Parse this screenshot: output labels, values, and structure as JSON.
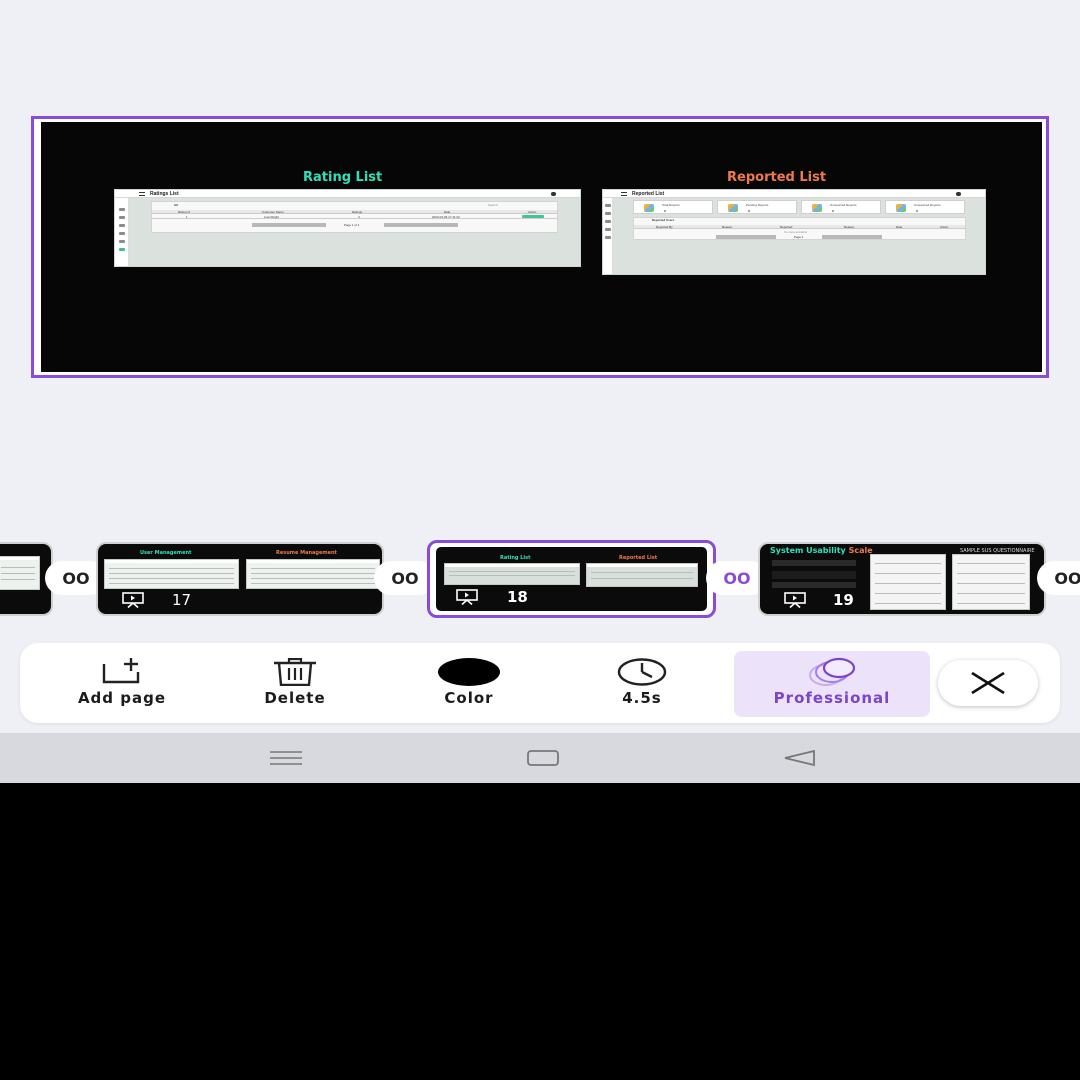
{
  "preview": {
    "left_heading": "Rating List",
    "right_heading": "Reported List",
    "left_heading_color": "#2fe0b8",
    "right_heading_color": "#f07a4a",
    "rating_shot": {
      "title": "Ratings List",
      "filter": "All",
      "search": "Search",
      "columns": [
        "Rating Id",
        "Customer Name",
        "Ratings",
        "Date",
        "Action"
      ],
      "row": [
        "1",
        "Lisa Wright",
        "4",
        "2023-03-09 17:11:32",
        "View"
      ],
      "pagination": "Page 1 of 1"
    },
    "reported_shot": {
      "title": "Reported List",
      "cards": [
        {
          "label": "Total Reports",
          "value": "0"
        },
        {
          "label": "Pending Reports",
          "value": "0"
        },
        {
          "label": "Unresolved Reports",
          "value": "0"
        },
        {
          "label": "Unresolved Reports",
          "value": "0"
        }
      ],
      "section": "Reported Users",
      "columns": [
        "Reported By",
        "Reason",
        "Reported",
        "Reason",
        "Date",
        "Action"
      ],
      "empty": "No data available",
      "pagination": "Page 1"
    }
  },
  "thumbnails": [
    {
      "number": "",
      "left_label": "",
      "right_label": ""
    },
    {
      "number": "17",
      "left_label": "User Management",
      "right_label": "Resume Management"
    },
    {
      "number": "18",
      "left_label": "Rating List",
      "right_label": "Reported List"
    },
    {
      "number": "19",
      "left_label": "System Usability",
      "left_label_2": "Scale",
      "right_label": "SAMPLE SUS QUESTIONNAIRE"
    }
  ],
  "transitions": [
    "OO",
    "OO",
    "OO",
    "OO"
  ],
  "toolbar": {
    "add_page": "Add page",
    "delete": "Delete",
    "color": "Color",
    "duration": "4.5s",
    "style": "Professional"
  },
  "colors": {
    "accent": "#8a4cd8",
    "background": "#eff0f5",
    "slide_background": "#060606",
    "swatch": "#000000"
  }
}
